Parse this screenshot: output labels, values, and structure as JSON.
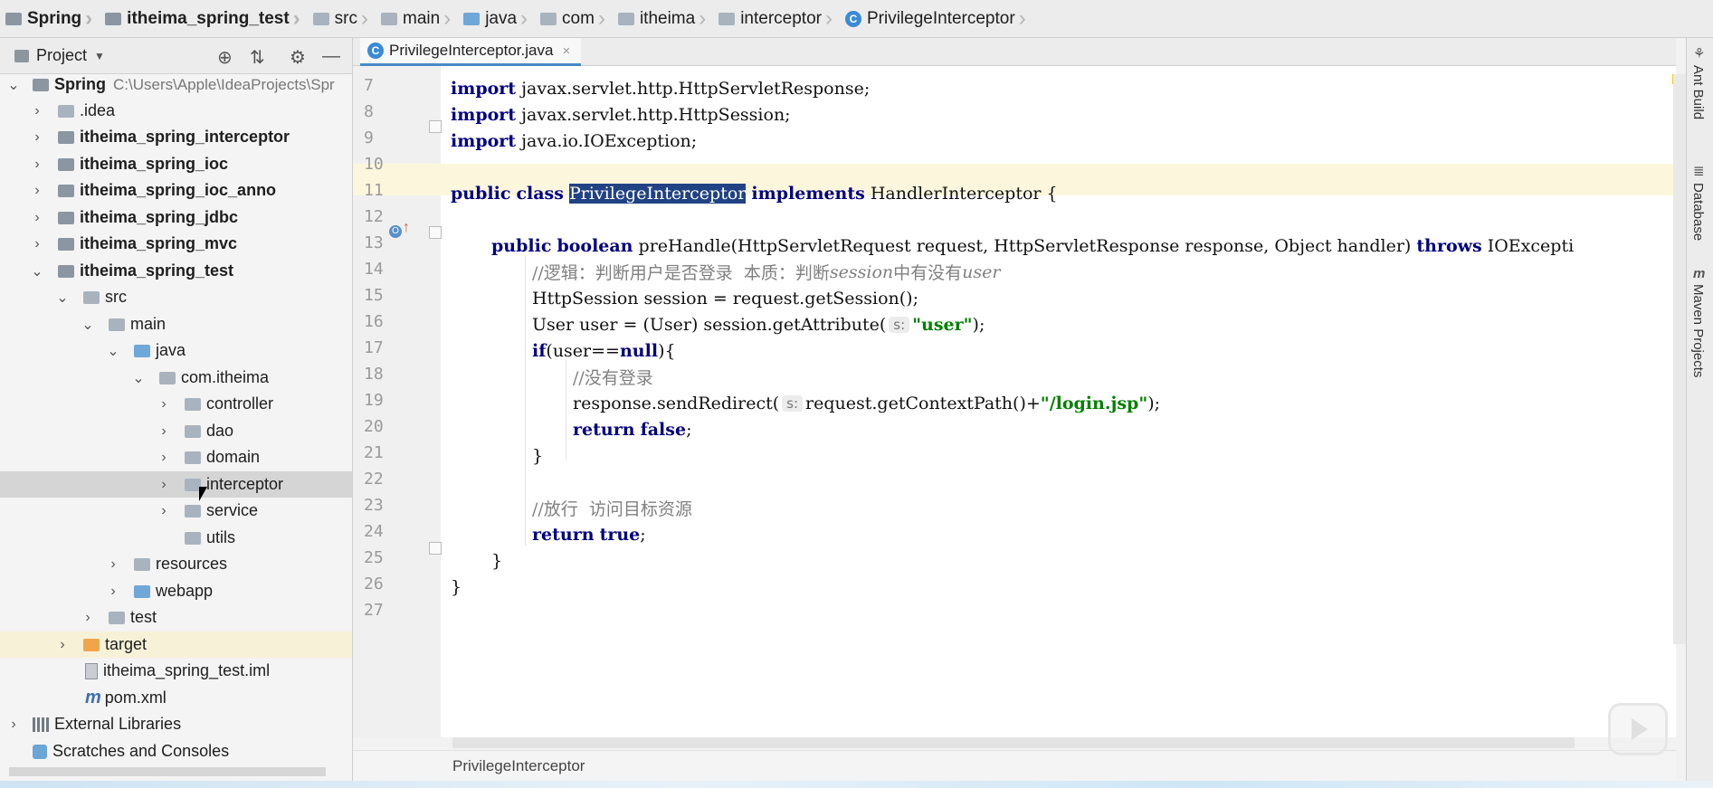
{
  "breadcrumb": [
    "Spring",
    "itheima_spring_test",
    "src",
    "main",
    "java",
    "com",
    "itheima",
    "interceptor",
    "PrivilegeInterceptor"
  ],
  "project_panel": {
    "title": "Project",
    "tree": [
      {
        "label": "Spring",
        "path": "C:\\Users\\Apple\\IdeaProjects\\Spr",
        "bold": true
      },
      {
        "label": ".idea"
      },
      {
        "label": "itheima_spring_interceptor",
        "bold": true
      },
      {
        "label": "itheima_spring_ioc",
        "bold": true
      },
      {
        "label": "itheima_spring_ioc_anno",
        "bold": true
      },
      {
        "label": "itheima_spring_jdbc",
        "bold": true
      },
      {
        "label": "itheima_spring_mvc",
        "bold": true
      },
      {
        "label": "itheima_spring_test",
        "bold": true
      },
      {
        "label": "src"
      },
      {
        "label": "main"
      },
      {
        "label": "java"
      },
      {
        "label": "com.itheima"
      },
      {
        "label": "controller"
      },
      {
        "label": "dao"
      },
      {
        "label": "domain"
      },
      {
        "label": "interceptor"
      },
      {
        "label": "service"
      },
      {
        "label": "utils"
      },
      {
        "label": "resources"
      },
      {
        "label": "webapp"
      },
      {
        "label": "test"
      },
      {
        "label": "target"
      },
      {
        "label": "itheima_spring_test.iml"
      },
      {
        "label": "pom.xml"
      },
      {
        "label": "External Libraries"
      },
      {
        "label": "Scratches and Consoles"
      }
    ]
  },
  "editor": {
    "tab_label": "PrivilegeInterceptor.java",
    "tab_close": "×",
    "line_numbers": [
      "7",
      "8",
      "9",
      "10",
      "11",
      "12",
      "13",
      "14",
      "15",
      "16",
      "17",
      "18",
      "19",
      "20",
      "21",
      "22",
      "23",
      "24",
      "25",
      "26",
      "27"
    ],
    "code": {
      "l7_kw": "import",
      "l7_rest": " javax.servlet.http.HttpServletResponse;",
      "l8_kw": "import",
      "l8_rest": " javax.servlet.http.HttpSession;",
      "l9_kw": "import",
      "l9_rest": " java.io.IOException;",
      "l11_kw1": "public",
      "l11_kw2": "class",
      "l11_name": "PrivilegeInterceptor",
      "l11_kw3": "implements",
      "l11_rest": " HandlerInterceptor {",
      "l13_kw1": "public",
      "l13_kw2": "boolean",
      "l13_sig": " preHandle(HttpServletRequest request, HttpServletResponse response, Object handler) ",
      "l13_kw3": "throws",
      "l13_rest": " IOExcepti",
      "l14_c1": "//逻辑：判断用户是否登录  本质：判断",
      "l14_c2": "session",
      "l14_c3": "中有没有",
      "l14_c4": "user",
      "l15": "HttpSession session = request.getSession();",
      "l16_a": "User user = (User) session.getAttribute(",
      "l16_hint": "s:",
      "l16_str": "\"user\"",
      "l16_b": ");",
      "l17_kw": "if",
      "l17_a": "(user==",
      "l17_kw2": "null",
      "l17_b": "){",
      "l18_c": "//没有登录",
      "l19_a": "response.sendRedirect(",
      "l19_hint": "s:",
      "l19_b": "request.getContextPath()+",
      "l19_str": "\"/login.jsp\"",
      "l19_c": ");",
      "l20_kw1": "return",
      "l20_kw2": "false",
      "l20_rest": ";",
      "l21": "}",
      "l23_c": "//放行  访问目标资源",
      "l24_kw1": "return",
      "l24_kw2": "true",
      "l24_rest": ";",
      "l25": "}",
      "l26": "}"
    },
    "footer_crumb": "PrivilegeInterceptor"
  },
  "right_strip": [
    "Ant Build",
    "Database",
    "Maven Projects"
  ],
  "colors": {
    "keyword": "#000080",
    "string": "#008000",
    "comment": "#808080",
    "selection": "#214283",
    "current_line": "#fcf7dc"
  }
}
